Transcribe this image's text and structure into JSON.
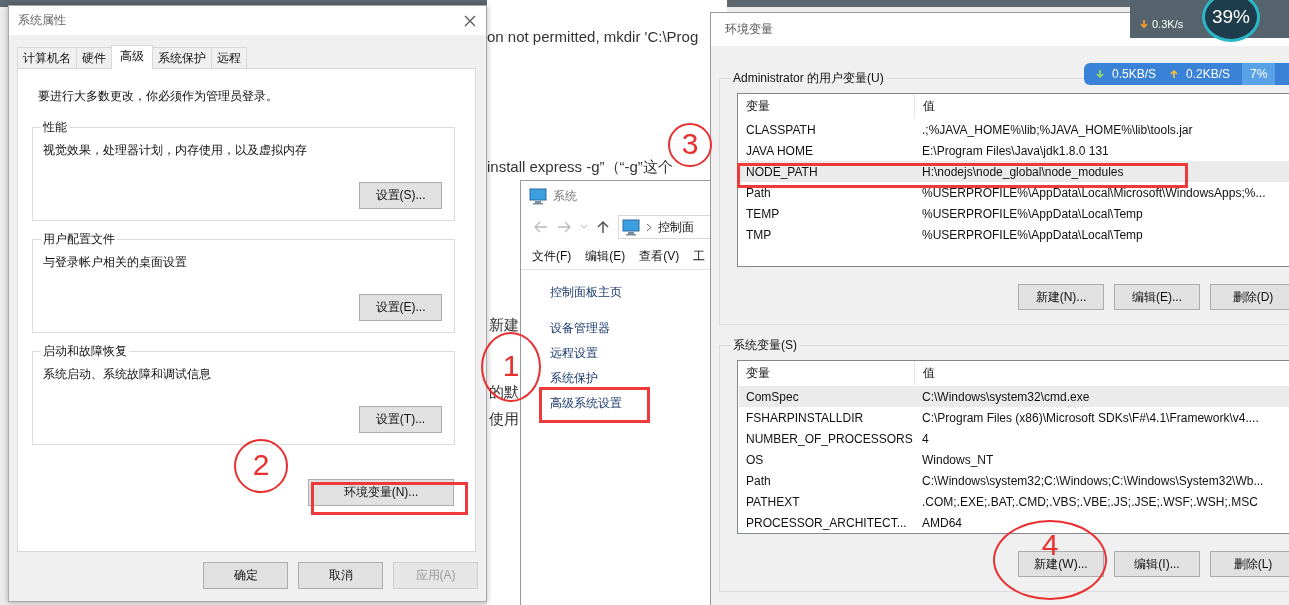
{
  "net_widget": {
    "download": "0.3K/s",
    "cpu": "39%"
  },
  "background_page": {
    "lines": [
      "on not permitted, mkdir 'C:\\Prog",
      "install  express  -g”（“-g”这个",
      "新建",
      "的默",
      "使用"
    ]
  },
  "system_properties": {
    "title": "系统属性",
    "tabs": [
      {
        "label": "计算机名",
        "selected": false
      },
      {
        "label": "硬件",
        "selected": false
      },
      {
        "label": "高级",
        "selected": true
      },
      {
        "label": "系统保护",
        "selected": false
      },
      {
        "label": "远程",
        "selected": false
      }
    ],
    "notice": "要进行大多数更改，你必须作为管理员登录。",
    "groups": [
      {
        "title": "性能",
        "description": "视觉效果，处理器计划，内存使用，以及虚拟内存",
        "button": "设置(S)..."
      },
      {
        "title": "用户配置文件",
        "description": "与登录帐户相关的桌面设置",
        "button": "设置(E)..."
      },
      {
        "title": "启动和故障恢复",
        "description": "系统启动、系统故障和调试信息",
        "button": "设置(T)..."
      }
    ],
    "env_button": "环境变量(N)...",
    "buttons": [
      {
        "label": "确定",
        "disabled": false
      },
      {
        "label": "取消",
        "disabled": false
      },
      {
        "label": "应用(A)",
        "disabled": true
      }
    ]
  },
  "system_window": {
    "title": "系统",
    "address": "控制面",
    "menu": [
      "文件(F)",
      "编辑(E)",
      "查看(V)",
      "工"
    ],
    "links": [
      "控制面板主页",
      "设备管理器",
      "远程设置",
      "系统保护",
      "高级系统设置"
    ]
  },
  "environment_variables": {
    "title": "环境变量",
    "net_bar": {
      "download": "0.5KB/S",
      "upload": "0.2KB/S",
      "percent": "7%"
    },
    "sections": [
      {
        "label": "Administrator 的用户变量(U)",
        "columns": [
          "变量",
          "值"
        ],
        "rows": [
          {
            "name": "CLASSPATH",
            "value": " .;%JAVA_HOME%\\lib;%JAVA_HOME%\\lib\\tools.jar",
            "selected": false
          },
          {
            "name": "JAVA HOME",
            "value": "E:\\Program Files\\Java\\jdk1.8.0 131",
            "selected": false
          },
          {
            "name": "NODE_PATH",
            "value": "H:\\nodejs\\node_global\\node_modules",
            "selected": true
          },
          {
            "name": "Path",
            "value": "%USERPROFILE%\\AppData\\Local\\Microsoft\\WindowsApps;%...",
            "selected": false
          },
          {
            "name": "TEMP",
            "value": "%USERPROFILE%\\AppData\\Local\\Temp",
            "selected": false
          },
          {
            "name": "TMP",
            "value": "%USERPROFILE%\\AppData\\Local\\Temp",
            "selected": false
          }
        ],
        "buttons": [
          "新建(N)...",
          "编辑(E)...",
          "删除(D)"
        ]
      },
      {
        "label": "系统变量(S)",
        "columns": [
          "变量",
          "值"
        ],
        "rows": [
          {
            "name": "ComSpec",
            "value": "C:\\Windows\\system32\\cmd.exe",
            "selected": true
          },
          {
            "name": "FSHARPINSTALLDIR",
            "value": "C:\\Program Files (x86)\\Microsoft SDKs\\F#\\4.1\\Framework\\v4....",
            "selected": false
          },
          {
            "name": "NUMBER_OF_PROCESSORS",
            "value": "4",
            "selected": false
          },
          {
            "name": "OS",
            "value": "Windows_NT",
            "selected": false
          },
          {
            "name": "Path",
            "value": "C:\\Windows\\system32;C:\\Windows;C:\\Windows\\System32\\Wb...",
            "selected": false
          },
          {
            "name": "PATHEXT",
            "value": ".COM;.EXE;.BAT;.CMD;.VBS;.VBE;.JS;.JSE;.WSF;.WSH;.MSC",
            "selected": false
          },
          {
            "name": "PROCESSOR_ARCHITECT...",
            "value": "AMD64",
            "selected": false
          }
        ],
        "buttons": [
          "新建(W)...",
          "编辑(I)...",
          "删除(L)"
        ]
      }
    ]
  },
  "annotations": [
    {
      "kind": "circle",
      "label": "1"
    },
    {
      "kind": "circle",
      "label": "2"
    },
    {
      "kind": "circle",
      "label": "3"
    },
    {
      "kind": "circle",
      "label": "4"
    },
    {
      "kind": "rect"
    },
    {
      "kind": "rect"
    },
    {
      "kind": "rect"
    }
  ]
}
